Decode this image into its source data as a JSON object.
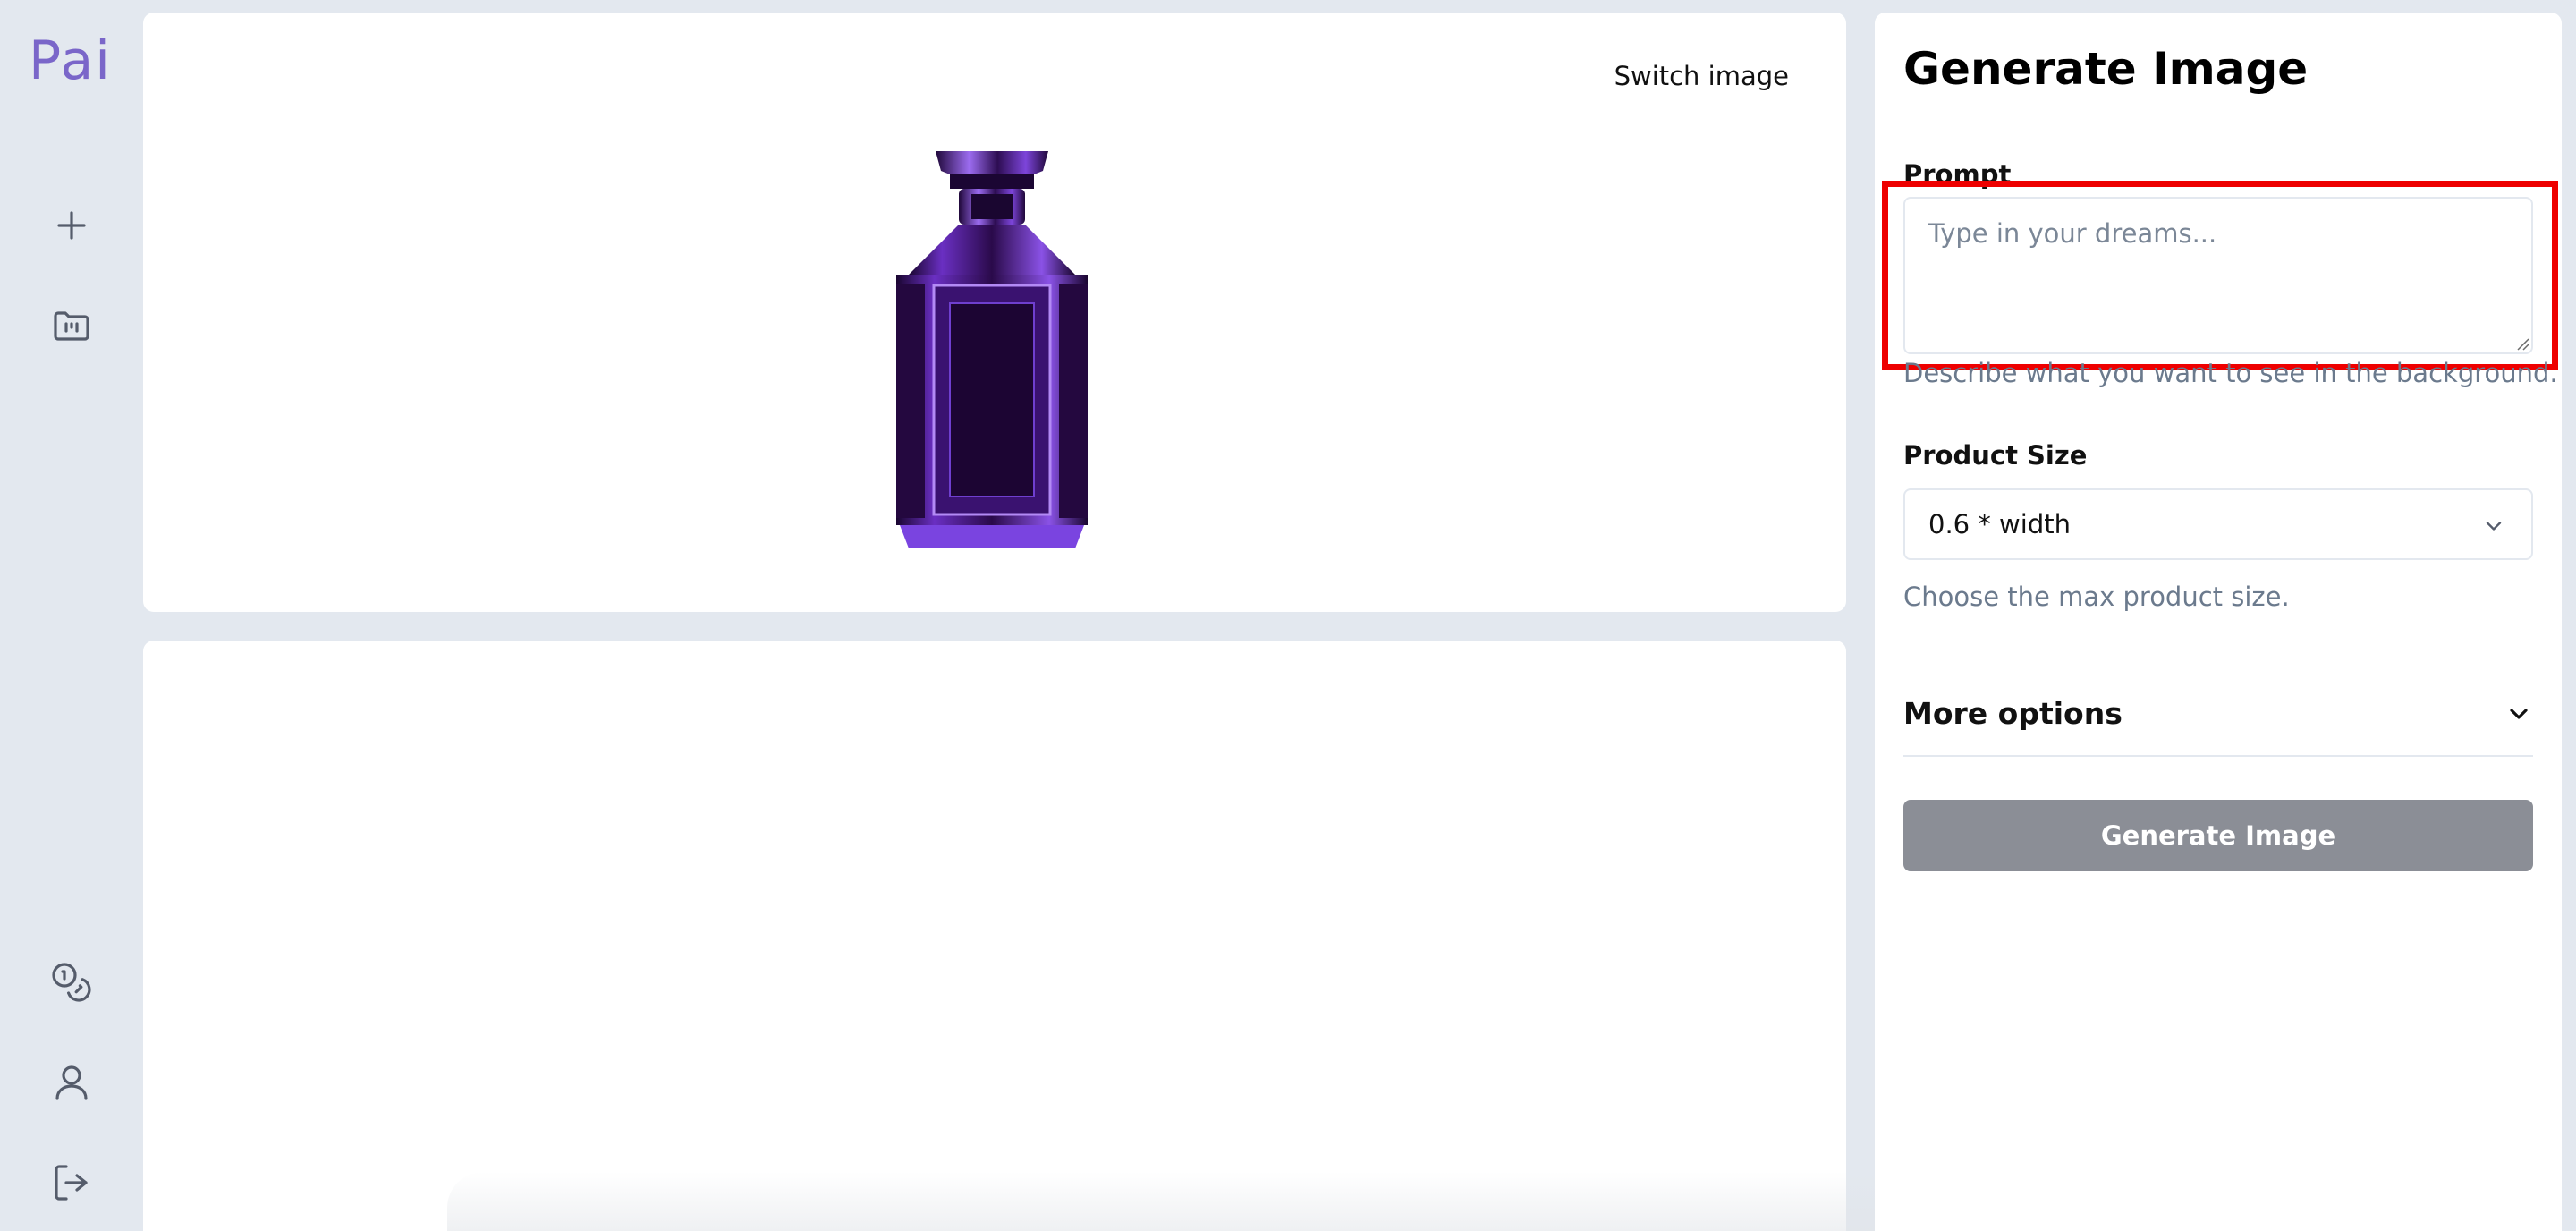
{
  "app": {
    "logo_text": "Pai"
  },
  "sidebar": {
    "top_items": [
      {
        "name": "new",
        "icon": "plus-icon"
      },
      {
        "name": "folder",
        "icon": "folder-chart-icon"
      }
    ],
    "bottom_items": [
      {
        "name": "credits",
        "icon": "coins-icon"
      },
      {
        "name": "account",
        "icon": "user-icon"
      },
      {
        "name": "logout",
        "icon": "logout-icon"
      }
    ]
  },
  "preview": {
    "switch_label": "Switch image",
    "product_alt": "purple-perfume-bottle"
  },
  "panel": {
    "title": "Generate Image",
    "prompt": {
      "label": "Prompt",
      "value": "",
      "placeholder": "Type in your dreams...",
      "helper": "Describe what you want to see in the background."
    },
    "product_size": {
      "label": "Product Size",
      "selected": "0.6 * width",
      "helper": "Choose the max product size."
    },
    "more_options_label": "More options",
    "generate_label": "Generate Image"
  },
  "colors": {
    "background": "#e3e8ef",
    "brand": "#7a66c9",
    "highlight": "#ee0000",
    "button_disabled": "#8b8e96",
    "helper_text": "#6b7a8d"
  }
}
